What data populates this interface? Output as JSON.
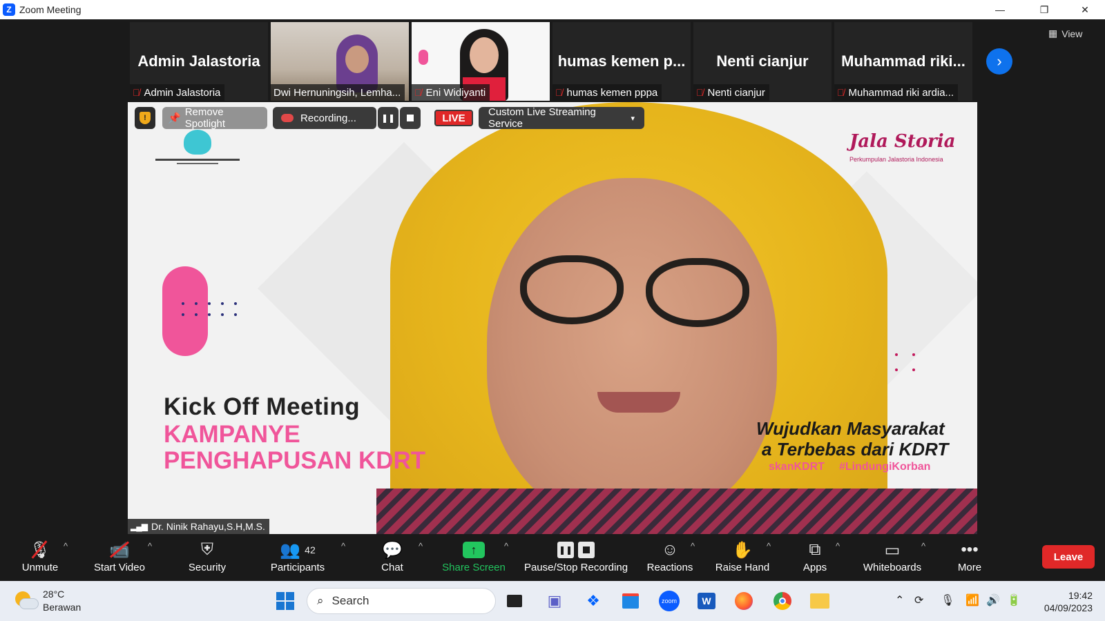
{
  "window": {
    "title": "Zoom Meeting",
    "minimize_glyph": "—",
    "restore_glyph": "❐",
    "close_glyph": "✕"
  },
  "gallery": {
    "view_label": "View",
    "tiles": [
      {
        "big_name": "Admin Jalastoria",
        "caption": "Admin Jalastoria",
        "video": false
      },
      {
        "big_name": "",
        "caption": "Dwi Hernuningsih, Lemha...",
        "video": true
      },
      {
        "big_name": "",
        "caption": "Eni Widiyanti",
        "video": true
      },
      {
        "big_name": "humas kemen p...",
        "caption": "humas kemen pppa",
        "video": false
      },
      {
        "big_name": "Nenti cianjur",
        "caption": "Nenti cianjur",
        "video": false
      },
      {
        "big_name": "Muhammad riki...",
        "caption": "Muhammad riki ardia...",
        "video": false
      }
    ],
    "next_glyph": "›"
  },
  "video_overlay": {
    "remove_spotlight": "Remove Spotlight",
    "recording": "Recording...",
    "live": "LIVE",
    "stream_service": "Custom Live Streaming Service",
    "stream_caret": "▾"
  },
  "slide": {
    "line1": "Kick Off Meeting",
    "line2": "KAMPANYE",
    "line3": "PENGHAPUSAN KDRT",
    "slogan1": "Wujudkan Masyarakat",
    "slogan2": "a Terbebas dari KDRT",
    "hashtag1": "skanKDRT",
    "hashtag2": "#LindungiKorban",
    "org_logo": "Jala Storia",
    "org_sub": "Perkumpulan Jalastoria Indonesia"
  },
  "speaker": {
    "name": "Dr. Ninik Rahayu,S.H,M.S."
  },
  "toolbar": {
    "unmute": "Unmute",
    "start_video": "Start Video",
    "security": "Security",
    "participants": "Participants",
    "participants_count": "42",
    "chat": "Chat",
    "share_screen": "Share Screen",
    "pause_stop_recording": "Pause/Stop Recording",
    "reactions": "Reactions",
    "raise_hand": "Raise Hand",
    "apps": "Apps",
    "whiteboards": "Whiteboards",
    "more": "More",
    "leave": "Leave",
    "caret": "^"
  },
  "taskbar": {
    "temperature": "28°C",
    "condition": "Berawan",
    "search_placeholder": "Search",
    "time": "19:42",
    "date": "04/09/2023"
  },
  "colors": {
    "accent": "#0e72ed",
    "live": "#e02828",
    "share": "#22c55e",
    "pink": "#f0559a"
  }
}
